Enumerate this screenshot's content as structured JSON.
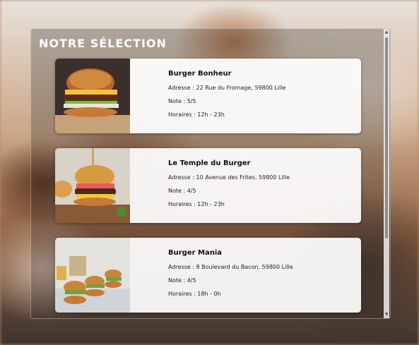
{
  "page": {
    "heading": "NOTRE SÉLECTION"
  },
  "restaurants": [
    {
      "name": "Burger Bonheur",
      "address": "Adresse : 22 Rue du Fromage, 59800 Lille",
      "rating": "Note : 5/5",
      "hours": "Horaires : 12h - 23h"
    },
    {
      "name": "Le Temple du Burger",
      "address": "Adresse : 10 Avenue des Frites, 59800 Lille",
      "rating": "Note : 4/5",
      "hours": "Horaires : 12h - 23h"
    },
    {
      "name": "Burger Mania",
      "address": "Adresse : 8 Boulevard du Bacon, 59800 Lille",
      "rating": "Note : 4/5",
      "hours": "Horaires : 18h - 0h"
    }
  ],
  "icons": {
    "scroll_up": "scroll-up-arrow-icon",
    "scroll_down": "scroll-down-arrow-icon"
  },
  "colors": {
    "heading": "#ffffff",
    "card_background": "#ffffff",
    "text": "#111111"
  }
}
